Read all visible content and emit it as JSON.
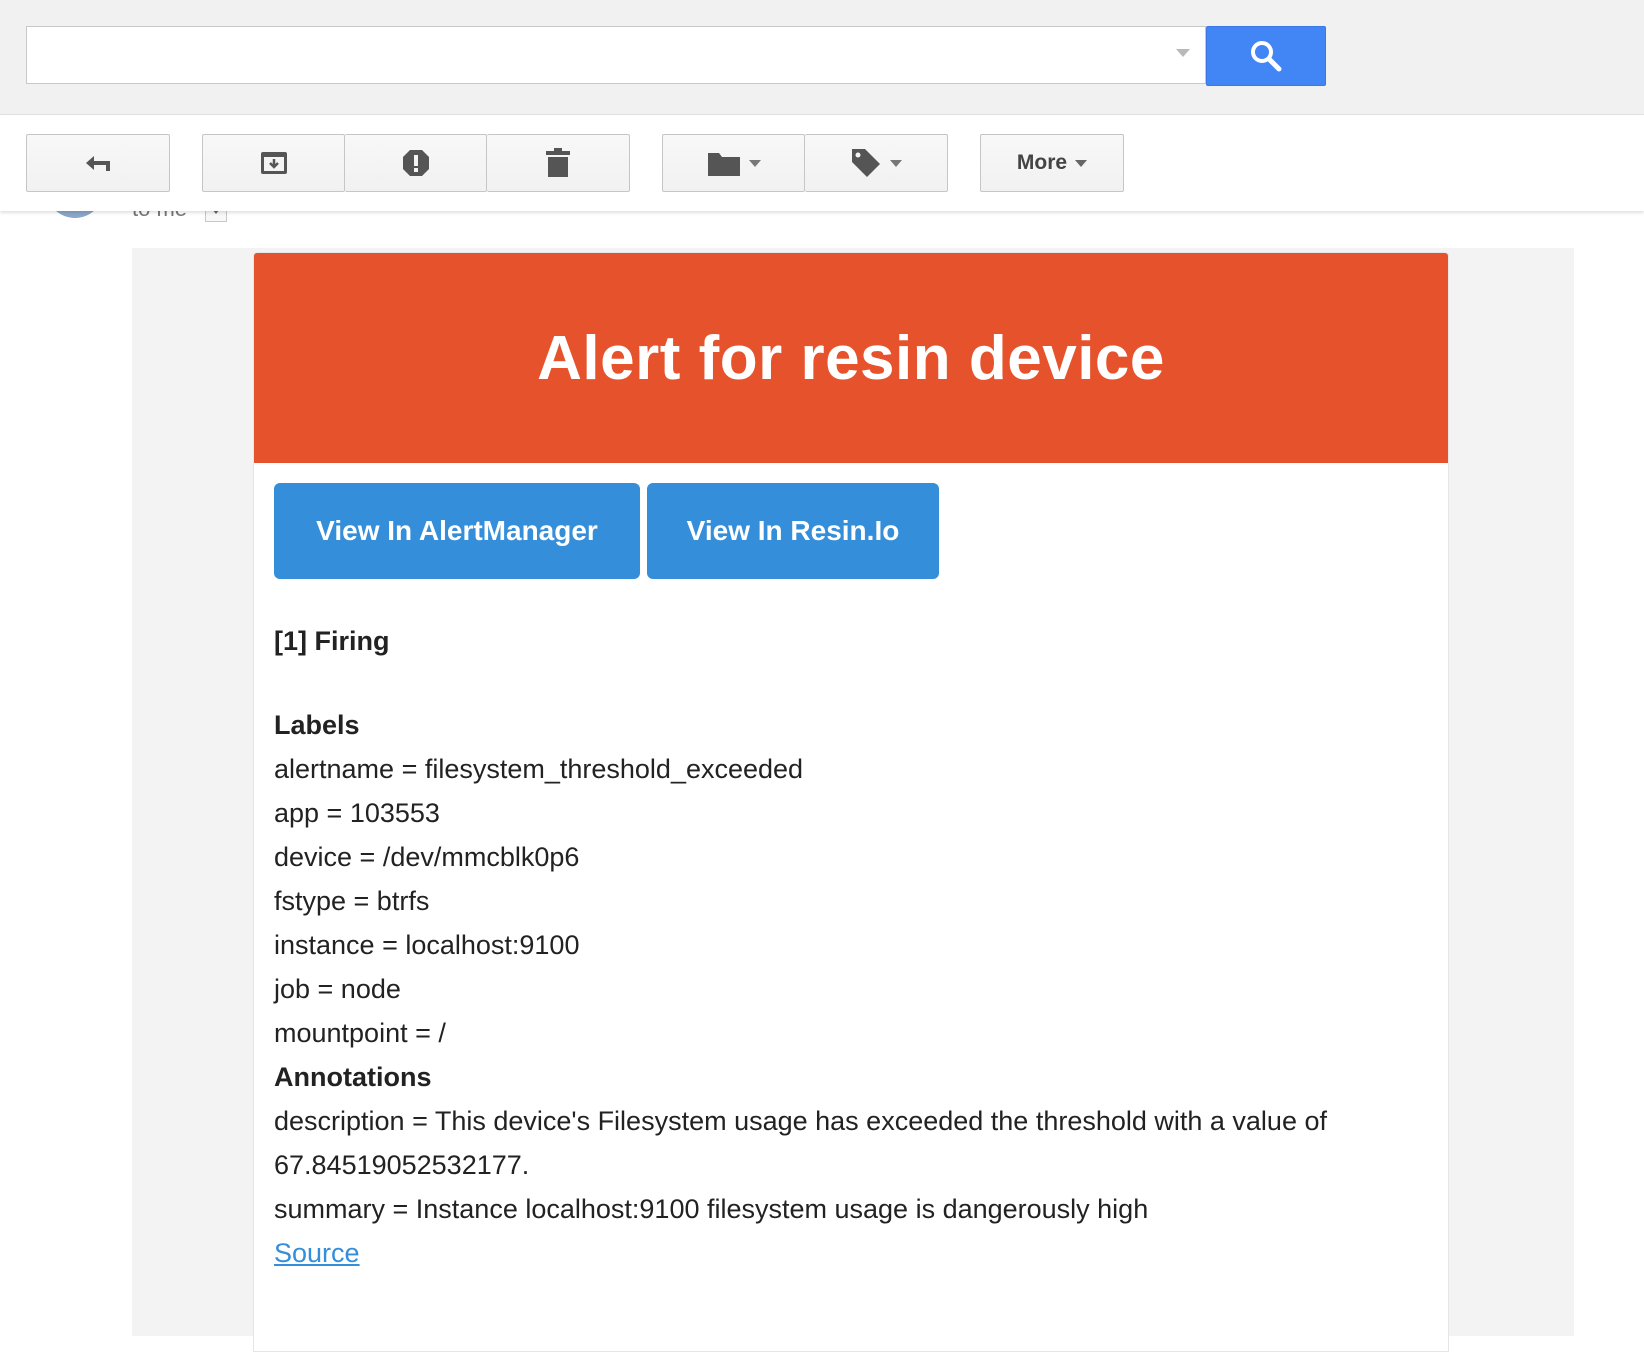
{
  "search": {
    "value": "",
    "placeholder": ""
  },
  "toolbar": {
    "more_label": "More"
  },
  "message": {
    "recipient_label": "to me"
  },
  "email": {
    "banner_title": "Alert for resin device",
    "buttons": {
      "alertmanager": "View In AlertManager",
      "resin": "View In Resin.Io"
    },
    "status": "[1] Firing",
    "labels_heading": "Labels",
    "labels": [
      "alertname = filesystem_threshold_exceeded",
      "app = 103553",
      "device = /dev/mmcblk0p6",
      "fstype = btrfs",
      "instance = localhost:9100",
      "job = node",
      "mountpoint = /"
    ],
    "annotations_heading": "Annotations",
    "annotations": [
      "description = This device's Filesystem usage has exceeded the threshold with a value of",
      "67.84519052532177.",
      "summary = Instance localhost:9100 filesystem usage is dangerously high"
    ],
    "source_link": "Source"
  },
  "colors": {
    "banner": "#e6522c",
    "button": "#348eda",
    "search_button": "#4285f4",
    "link": "#348eda"
  }
}
